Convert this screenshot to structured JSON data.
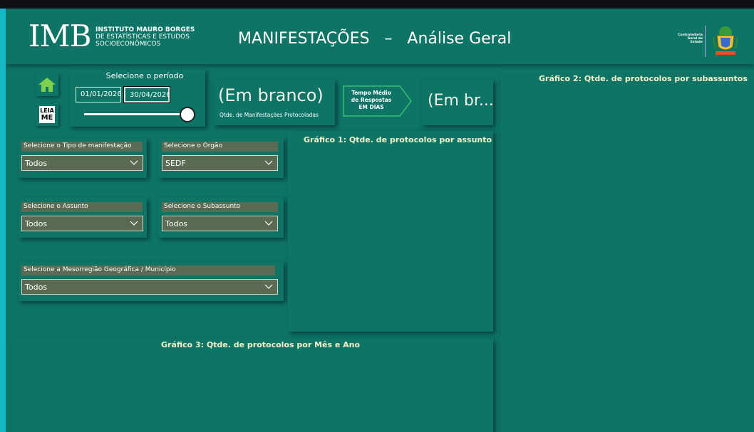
{
  "header": {
    "logo_text": "IMB",
    "logo_sub_line1": "INSTITUTO MAURO BORGES",
    "logo_sub_line2": "DE ESTATÍSTICAS E ESTUDOS",
    "logo_sub_line3": "SOCIOECONÔMICOS",
    "title": "MANIFESTAÇÕES   –   Análise Geral",
    "cge_line1": "Controladoria",
    "cge_line2": "Geral do",
    "cge_line3": "Estado"
  },
  "nav": {
    "home_icon": "home-icon",
    "leiame_line1": "LEIA",
    "leiame_line2": "ME"
  },
  "periodo": {
    "label": "Selecione o período",
    "start": "01/01/2026",
    "end": "30/04/2026"
  },
  "kpi1": {
    "value": "(Em branco)",
    "label": "Qtde. de Manifestações Protocoladas"
  },
  "tempo": {
    "line1": "Tempo Médio",
    "line2": "de Respostas",
    "line3": "EM DIAS"
  },
  "kpi2": {
    "value": "(Em br..."
  },
  "filters": {
    "tipo": {
      "label": "Selecione o Tipo de manifestação",
      "value": "Todos"
    },
    "orgao": {
      "label": "Selecione o Órgão",
      "value": "SEDF"
    },
    "assunto": {
      "label": "Selecione o Assunto",
      "value": "Todos"
    },
    "subassunto": {
      "label": "Selecione o Subassunto",
      "value": "Todos"
    },
    "mesorregiao": {
      "label": "Selecione a Mesorregião Geográfica / Município",
      "value": "Todos"
    }
  },
  "charts": {
    "g1_title": "Gráfico 1: Qtde. de protocolos por assunto",
    "g2_title": "Gráfico 2: Qtde. de protocolos por subassuntos",
    "g3_title": "Gráfico 3: Qtde. de protocolos por Mês e Ano"
  },
  "colors": {
    "background": "#0d7466",
    "frame": "#14b8c4",
    "accent_title": "#f4f1c8",
    "slicer": "#5b6a52"
  }
}
